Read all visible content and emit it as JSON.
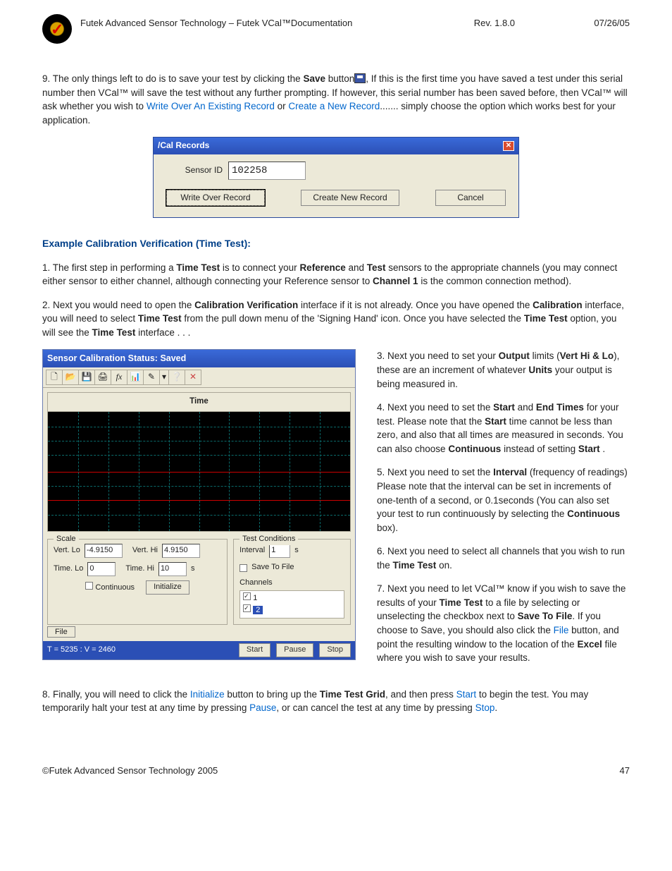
{
  "header": {
    "title": "Futek Advanced Sensor Technology – Futek VCal™Documentation",
    "rev": "Rev. 1.8.0",
    "date": "07/26/05"
  },
  "step9": {
    "pre": "9. The only things left to do is to save your test by clicking the ",
    "save_bold": "Save",
    "mid1": " button",
    "mid2": ", If this is the first time you have saved a test under this serial number then VCal™ will save the test without any further prompting. If however, this serial number has been saved before, then VCal™ will ask whether you wish to ",
    "link1": "Write Over An Existing Record",
    "or": " or ",
    "link2": "Create a New Record",
    "tail": "....... simply choose the option which works best for your application."
  },
  "dialog": {
    "title": "/Cal Records",
    "sensor_label": "Sensor ID",
    "sensor_value": "102258",
    "btn_write": "Write Over Record",
    "btn_new": "Create New Record",
    "btn_cancel": "Cancel"
  },
  "section_title": "Example Calibration Verification (Time Test):",
  "p1": {
    "a": "1. The first step in performing a ",
    "b1": "Time Test",
    "b": " is to connect your ",
    "b2": "Reference",
    "c": " and ",
    "b3": "Test",
    "d": " sensors to the appropriate channels (you may connect either sensor to either channel, although connecting your Reference sensor to ",
    "b4": "Channel 1",
    "e": " is the common connection method)."
  },
  "p2": {
    "a": "2. Next you would need to open the ",
    "b1": "Calibration Verification",
    "b": " interface if it is not already. Once you have opened the ",
    "b2": "Calibration",
    "c": " interface, you will need to select ",
    "b3": "Time Test",
    "d": " from the pull down menu of the 'Signing Hand' icon. Once you have selected the ",
    "b4": "Time Test",
    "e": " option, you will see the ",
    "b5": "Time Test",
    "f": " interface . . ."
  },
  "calwin": {
    "title": "Sensor Calibration  Status: Saved",
    "toolbar_icons": [
      "🗋",
      "📂",
      "💾",
      "🖨",
      "fx",
      "📊",
      "✎",
      "▾",
      "❔",
      "✕"
    ],
    "plot_label": "Time",
    "scale": {
      "legend": "Scale",
      "vlo_lbl": "Vert. Lo",
      "vlo": "-4.9150",
      "vhi_lbl": "Vert. Hi",
      "vhi": "4.9150",
      "tlo_lbl": "Time. Lo",
      "tlo": "0",
      "thi_lbl": "Time. Hi",
      "thi": "10",
      "unit": "s",
      "cont": "Continuous",
      "init": "Initialize"
    },
    "cond": {
      "legend": "Test Conditions",
      "interval_lbl": "Interval",
      "interval": "1",
      "interval_unit": "s",
      "save_lbl": "Save To File",
      "chan_lbl": "Channels",
      "ch1": "1",
      "ch2": "2"
    },
    "file_btn": "File",
    "status": "T = 5235 : V = 2460",
    "start": "Start",
    "pause": "Pause",
    "stop": "Stop"
  },
  "right": {
    "p3a": "3. Next you need to set your ",
    "p3b1": "Output",
    "p3b": " limits (",
    "p3b2": "Vert Hi & Lo",
    "p3c": "), these are an increment of whatever ",
    "p3b3": "Units",
    "p3d": " your output is being measured in.",
    "p4a": "4. Next you need to set the ",
    "p4b1": "Start",
    "p4b": " and ",
    "p4b2": "End Times",
    "p4c": " for your test. Please note that the ",
    "p4b3": "Start",
    "p4d": " time cannot be less than zero, and also that all times are measured in seconds. You can also choose ",
    "p4b4": "Continuous",
    "p4e": " instead of setting ",
    "p4b5": "Start",
    "p4f": " .",
    "p5a": "5. Next you need to set the ",
    "p5b1": "Interval",
    "p5b": " (frequency of readings) Please note that the interval can be set in increments of one-tenth of a second, or 0.1seconds (You can also set your test to run continuously by selecting the ",
    "p5b2": "Continuous",
    "p5c": " box).",
    "p6a": "6. Next you need to select all channels that you wish to run the ",
    "p6b1": "Time Test",
    "p6b": " on.",
    "p7a": "7. Next you need to let VCal™ know if you wish to save the results of your ",
    "p7b1": "Time Test",
    "p7b": " to a file by selecting or unselecting the checkbox next to ",
    "p7b2": "Save To File",
    "p7c": ". If you choose to Save, you should also click the ",
    "p7l1": "File",
    "p7d": " button, and point the resulting window to the location of the ",
    "p7b3": "Excel",
    "p7e": " file where you wish to save your results."
  },
  "p8": {
    "a": "8. Finally, you will need to click the ",
    "l1": "Initialize",
    "b": " button to bring up the ",
    "b1": "Time Test Grid",
    "c": ", and then press ",
    "l2": "Start",
    "d": " to begin the test. You may temporarily halt your test at any time by pressing ",
    "l3": "Pause",
    "e": ", or can cancel the test at any time by pressing ",
    "l4": "Stop",
    "f": "."
  },
  "footer": {
    "copy": "©Futek Advanced Sensor Technology 2005",
    "page": "47"
  }
}
